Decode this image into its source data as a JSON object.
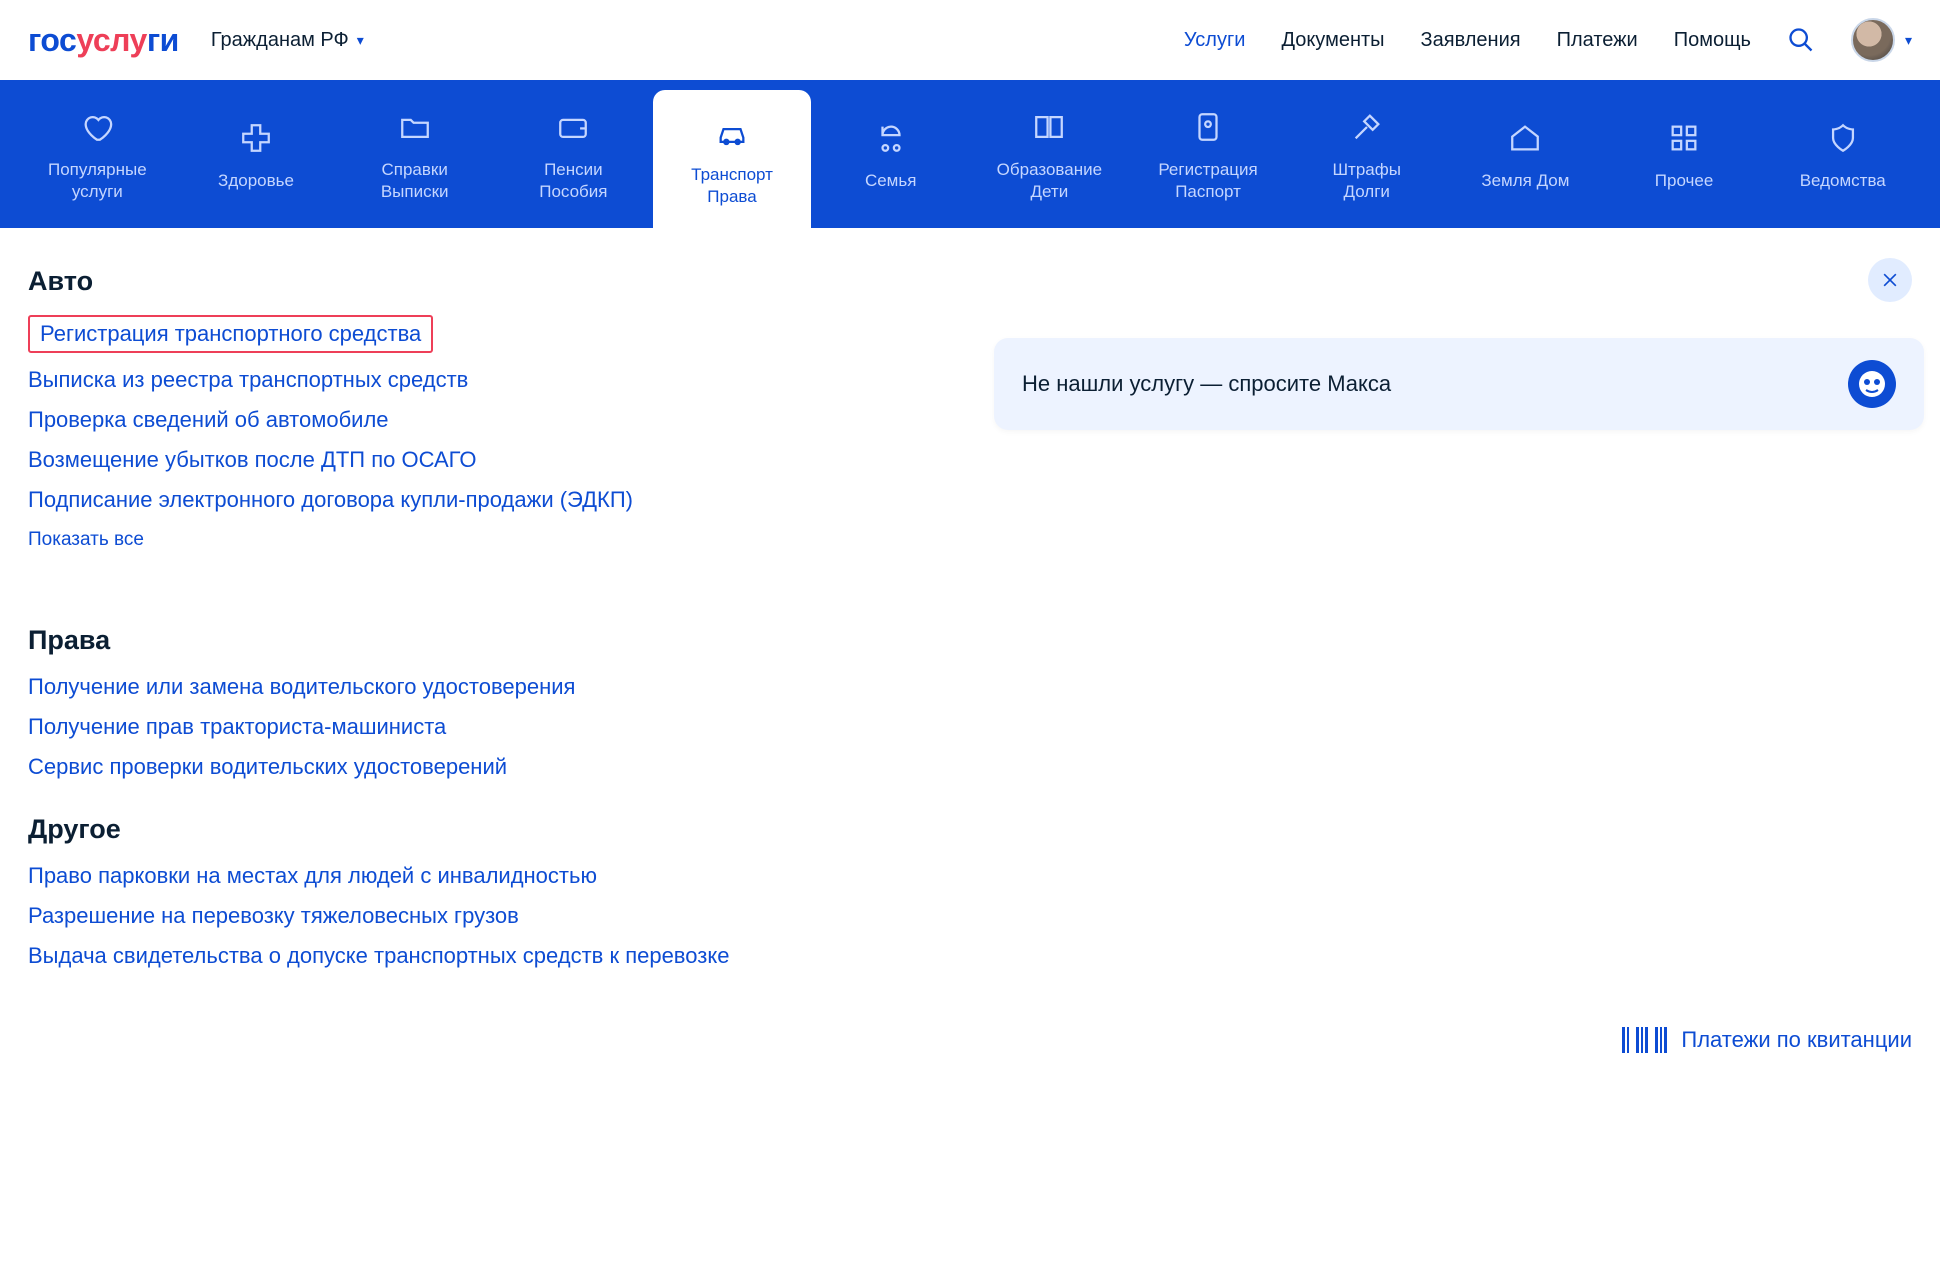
{
  "header": {
    "logo_gos": "гос",
    "logo_us": "услу",
    "logo_gi": "ги",
    "citizens_label": "Гражданам РФ",
    "nav": {
      "services": "Услуги",
      "documents": "Документы",
      "applications": "Заявления",
      "payments": "Платежи",
      "help": "Помощь"
    }
  },
  "categories": [
    {
      "label": "Популярные\nуслуги",
      "icon": "heart"
    },
    {
      "label": "Здоровье",
      "icon": "health"
    },
    {
      "label": "Справки\nВыписки",
      "icon": "folder"
    },
    {
      "label": "Пенсии\nПособия",
      "icon": "wallet"
    },
    {
      "label": "Транспорт\nПрава",
      "icon": "car",
      "active": true
    },
    {
      "label": "Семья",
      "icon": "stroller"
    },
    {
      "label": "Образование\nДети",
      "icon": "book"
    },
    {
      "label": "Регистрация\nПаспорт",
      "icon": "passport"
    },
    {
      "label": "Штрафы\nДолги",
      "icon": "gavel"
    },
    {
      "label": "Земля Дом",
      "icon": "home"
    },
    {
      "label": "Прочее",
      "icon": "grid"
    },
    {
      "label": "Ведомства",
      "icon": "emblem"
    }
  ],
  "sections": {
    "auto": {
      "title": "Авто",
      "links": [
        "Регистрация транспортного средства",
        "Выписка из реестра транспортных средств",
        "Проверка сведений об автомобиле",
        "Возмещение убытков после ДТП по ОСАГО",
        "Подписание электронного договора купли-продажи (ЭДКП)"
      ],
      "show_all": "Показать все"
    },
    "prava": {
      "title": "Права",
      "links": [
        "Получение или замена водительского удостоверения",
        "Получение прав тракториста-машиниста",
        "Сервис проверки водительских удостоверений"
      ]
    },
    "other": {
      "title": "Другое",
      "links": [
        "Право парковки на местах для людей с инвалидностью",
        "Разрешение на перевозку тяжеловесных грузов",
        "Выдача свидетельства о допуске транспортных средств к перевозке"
      ]
    }
  },
  "assist": {
    "text": "Не нашли услугу — спросите Макса"
  },
  "footer": {
    "payments_by_receipt": "Платежи по квитанции"
  }
}
